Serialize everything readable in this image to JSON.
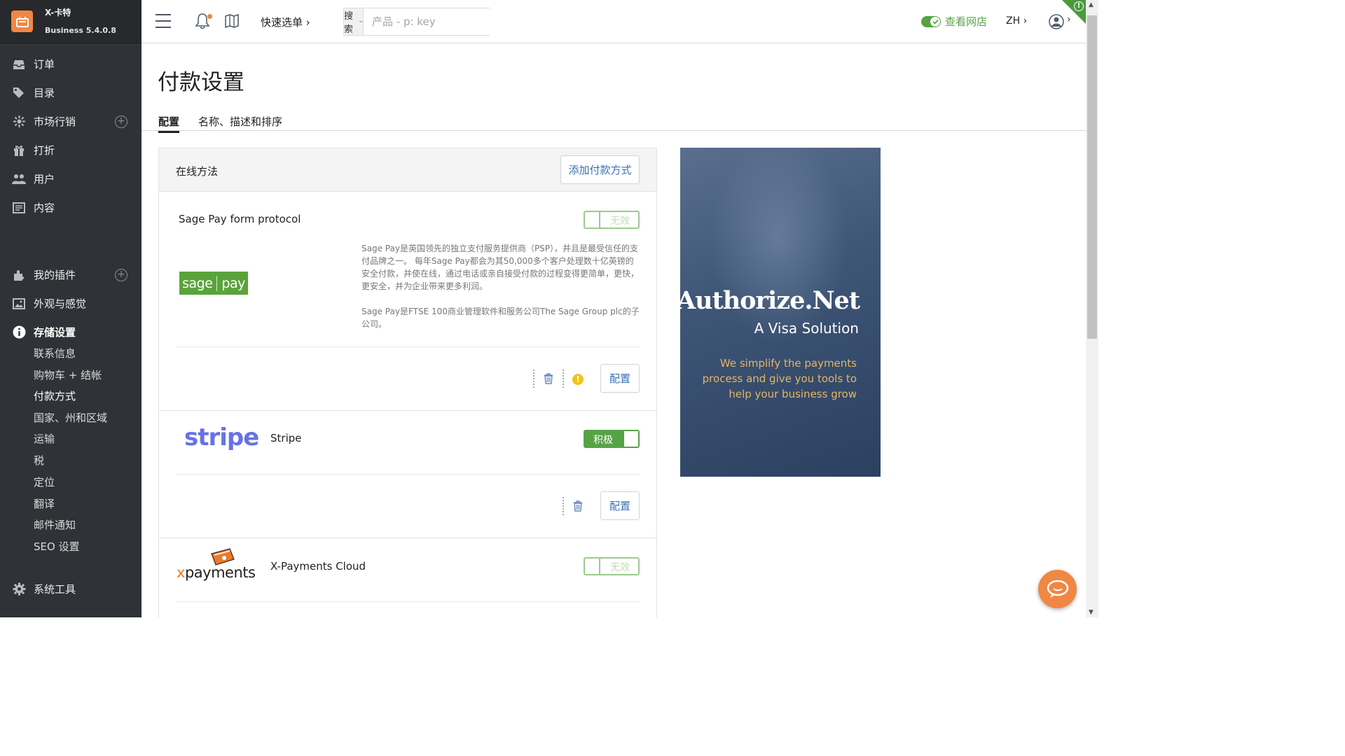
{
  "brand": {
    "name": "X-卡特",
    "version": "Business 5.4.0.8"
  },
  "sidebar": {
    "items": [
      {
        "label": "订单",
        "icon": "inbox-icon"
      },
      {
        "label": "目录",
        "icon": "tags-icon"
      },
      {
        "label": "市场行销",
        "icon": "marketing-icon"
      },
      {
        "label": "打折",
        "icon": "gift-icon"
      },
      {
        "label": "用户",
        "icon": "users-icon"
      },
      {
        "label": "内容",
        "icon": "content-icon"
      },
      {
        "label": "我的插件",
        "icon": "puzzle-icon"
      },
      {
        "label": "外观与感觉",
        "icon": "image-icon"
      },
      {
        "label": "存储设置",
        "icon": "info-icon"
      },
      {
        "label": "系统工具",
        "icon": "gear-icon"
      }
    ],
    "sub_items": [
      "联系信息",
      "购物车 + 结帐",
      "付款方式",
      "国家、州和区域",
      "运输",
      "税",
      "定位",
      "翻译",
      "邮件通知",
      "SEO 设置"
    ]
  },
  "topbar": {
    "quick_menu": "快速选单 ›",
    "search_type": "搜索",
    "search_placeholder": "产品 - p: key",
    "view_store": "查看网店",
    "lang": "ZH ›",
    "user_caret": "›"
  },
  "page": {
    "title": "付款设置",
    "tabs": [
      "配置",
      "名称、描述和排序"
    ]
  },
  "panel": {
    "title": "在线方法",
    "add_button": "添加付款方式",
    "configure_label": "配置",
    "methods": [
      {
        "name": "Sage Pay form protocol",
        "status": "无效",
        "logo_left": "sage",
        "logo_right": "pay",
        "desc1": "Sage Pay是英国领先的独立支付服务提供商（PSP），并且是最受信任的支付品牌之一。 每年Sage Pay都会为其50,000多个客户处理数十亿英镑的安全付款，并使在线，通过电话或亲自接受付款的过程变得更简单，更快，更安全，并为企业带来更多利润。",
        "desc2": "Sage Pay是FTSE 100商业管理软件和服务公司The Sage Group plc的子公司。"
      },
      {
        "name": "Stripe",
        "status": "积极",
        "logo": "stripe"
      },
      {
        "name": "X-Payments Cloud",
        "status": "无效",
        "logo_x": "x",
        "logo_rest": "payments"
      }
    ]
  },
  "ad": {
    "brand": "Authorize.Net",
    "sub": "A Visa Solution",
    "tagline": "We simplify the payments process and give you tools to help your business grow"
  },
  "colors": {
    "sidebar_bg": "#2f3337",
    "accent_orange": "#f08743",
    "active_green": "#56a346",
    "link_blue": "#3b6fb6"
  }
}
